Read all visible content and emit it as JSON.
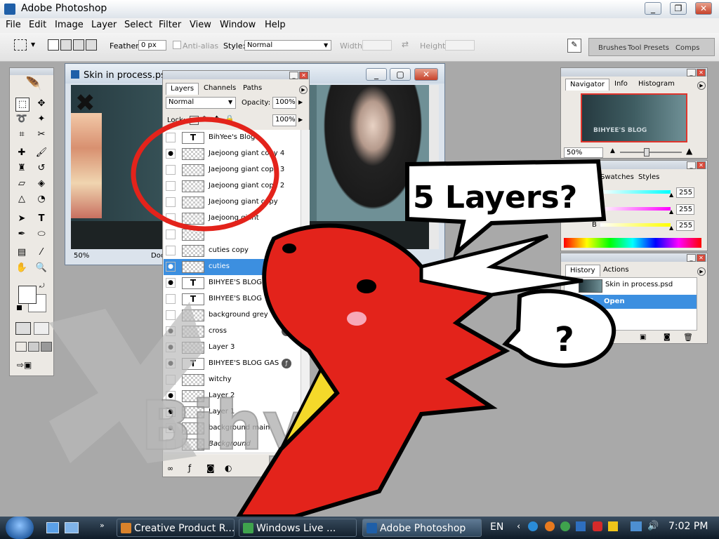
{
  "app": {
    "title": "Adobe Photoshop"
  },
  "menu": [
    "File",
    "Edit",
    "Image",
    "Layer",
    "Select",
    "Filter",
    "View",
    "Window",
    "Help"
  ],
  "options": {
    "feather_label": "Feather:",
    "feather_value": "0 px",
    "antialias_label": "Anti-alias",
    "style_label": "Style:",
    "style_value": "Normal",
    "width_label": "Width:",
    "height_label": "Height:",
    "wells": [
      "Brushes",
      "Tool Presets",
      "Comps"
    ]
  },
  "document": {
    "title": "Skin in process.psd",
    "zoom": "50%",
    "doc_label": "Doc"
  },
  "layers_panel": {
    "tabs": [
      "Layers",
      "Channels",
      "Paths"
    ],
    "blend_mode": "Normal",
    "opacity_label": "Opacity:",
    "opacity_value": "100%",
    "lock_label": "Lock:",
    "fill_value": "100%",
    "layers": [
      {
        "name": "BihYee's Blog",
        "type": "T",
        "visible": false
      },
      {
        "name": "Jaejoong giant copy 4",
        "visible": true
      },
      {
        "name": "Jaejoong giant copy 3",
        "visible": false
      },
      {
        "name": "Jaejoong giant copy 2",
        "visible": false
      },
      {
        "name": "Jaejoong giant copy",
        "visible": false
      },
      {
        "name": "Jaejoong giant",
        "visible": false
      },
      {
        "name": "",
        "visible": false
      },
      {
        "name": "cuties copy",
        "visible": false
      },
      {
        "name": "cuties",
        "visible": true,
        "selected": true
      },
      {
        "name": "BIHYEE'S BLOG GAS",
        "type": "T",
        "visible": true
      },
      {
        "name": "BIHYEE'S BLOG",
        "type": "T",
        "visible": false
      },
      {
        "name": "background grey",
        "visible": false
      },
      {
        "name": "cross",
        "visible": true,
        "fx": true
      },
      {
        "name": "Layer 3",
        "visible": true
      },
      {
        "name": "BIHYEE'S BLOG GAS",
        "type": "T",
        "visible": true,
        "fx": true
      },
      {
        "name": "witchy",
        "visible": false
      },
      {
        "name": "Layer 2",
        "visible": true
      },
      {
        "name": "Layer 1",
        "visible": true
      },
      {
        "name": "background main",
        "visible": true
      },
      {
        "name": "Background",
        "visible": false,
        "italic": true
      }
    ]
  },
  "navigator_panel": {
    "tabs": [
      "Navigator",
      "Info",
      "Histogram"
    ],
    "zoom": "50%",
    "preview_text": "BIHYEE'S BLOG"
  },
  "color_panel": {
    "tabs": [
      "Swatches",
      "Styles"
    ],
    "rows": [
      {
        "value": "255"
      },
      {
        "value": "255"
      },
      {
        "label": "B",
        "value": "255"
      }
    ]
  },
  "history_panel": {
    "tabs": [
      "History",
      "Actions"
    ],
    "items": [
      {
        "label": "Skin in process.psd"
      },
      {
        "label": "Open",
        "selected": true
      }
    ]
  },
  "annotations": {
    "bubble1": "5 Layers?",
    "bubble2": "?",
    "watermark": "Bihyee"
  },
  "taskbar": {
    "buttons": [
      {
        "label": "Creative Product R...",
        "active": false
      },
      {
        "label": "Windows Live ...",
        "active": false
      },
      {
        "label": "Adobe Photoshop",
        "active": true
      }
    ],
    "lang": "EN",
    "clock": "7:02 PM"
  },
  "colors": {
    "selection": "#3c8fe0",
    "annotation_red": "#e3231b",
    "annotation_yellow": "#f4d92a"
  }
}
